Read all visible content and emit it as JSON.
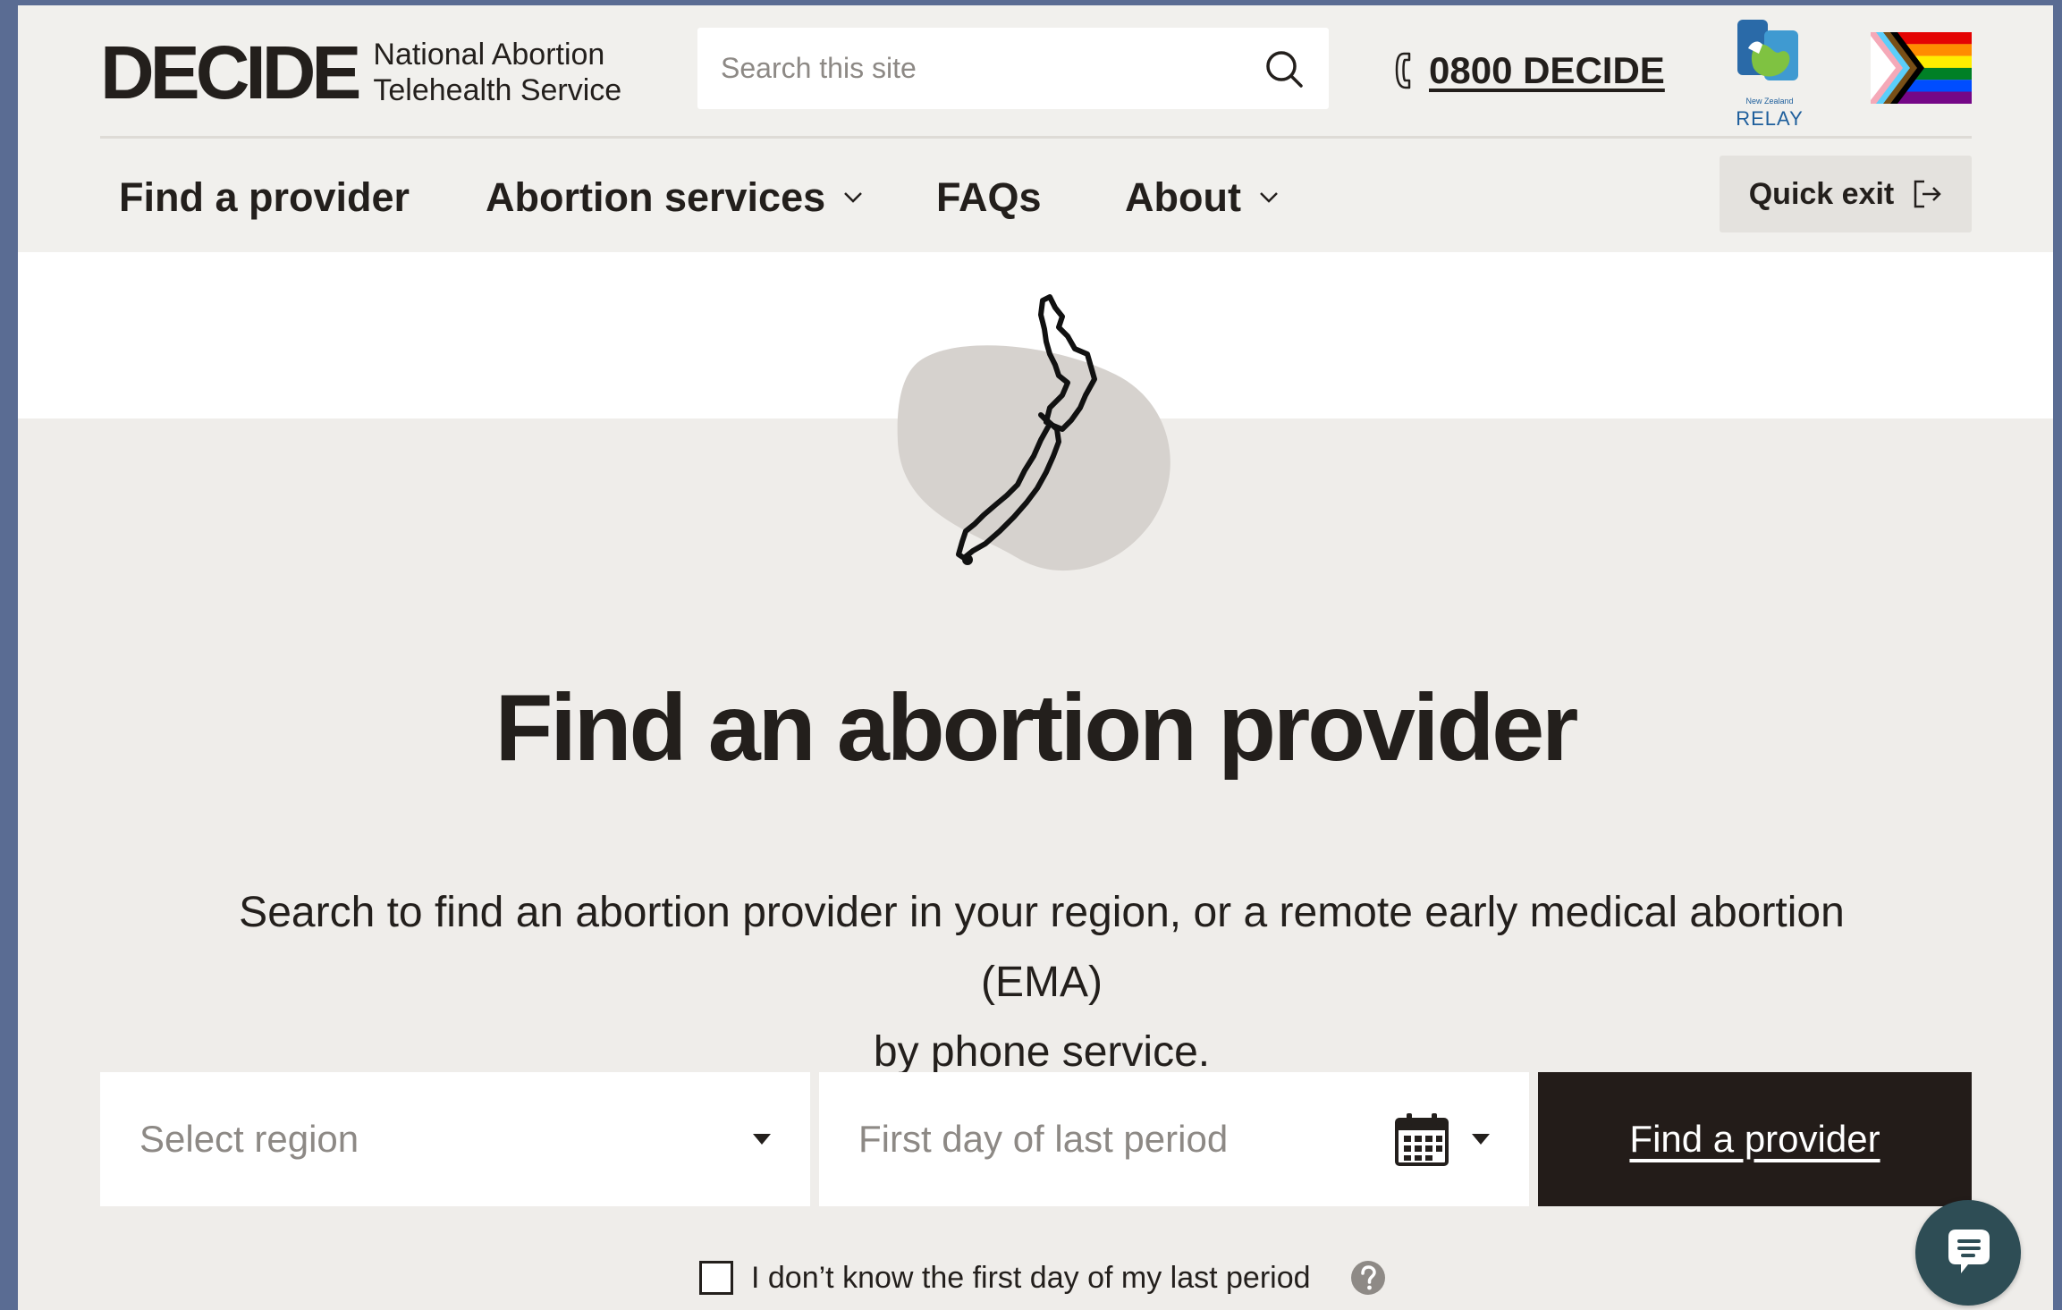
{
  "colors": {
    "background": "#efedea",
    "header": "#f1f0ed",
    "text": "#231f1c",
    "button_dark": "#231c19",
    "chat": "#2e4d55",
    "placeholder": "#8d8985"
  },
  "header": {
    "logo_word": "DECIDE",
    "logo_sub_line1": "National Abortion",
    "logo_sub_line2": "Telehealth Service",
    "search_placeholder": "Search this site",
    "search_icon": "search-icon",
    "phone_icon": "phone-icon",
    "phone_number": "0800 DECIDE",
    "relay_small": "New Zealand",
    "relay_label": "RELAY",
    "flag_icon": "progress-pride-flag"
  },
  "nav": {
    "items": [
      {
        "label": "Find a provider"
      },
      {
        "label": "Abortion services"
      },
      {
        "label": "FAQs"
      },
      {
        "label": "About"
      }
    ],
    "quick_exit": "Quick exit"
  },
  "hero": {
    "map_icon": "new-zealand-map-icon",
    "title": "Find an abortion provider",
    "description_line1": "Search to find an abortion provider in your region, or a remote early medical abortion (EMA)",
    "description_line2": "by phone service."
  },
  "search_form": {
    "region_placeholder": "Select region",
    "date_placeholder": "First day of last period",
    "calendar_icon": "calendar-icon",
    "submit_label": "Find a provider",
    "checkbox_label": "I don’t know the first day of my last period",
    "help_icon": "question-icon"
  },
  "chat": {
    "icon": "chat-icon"
  }
}
